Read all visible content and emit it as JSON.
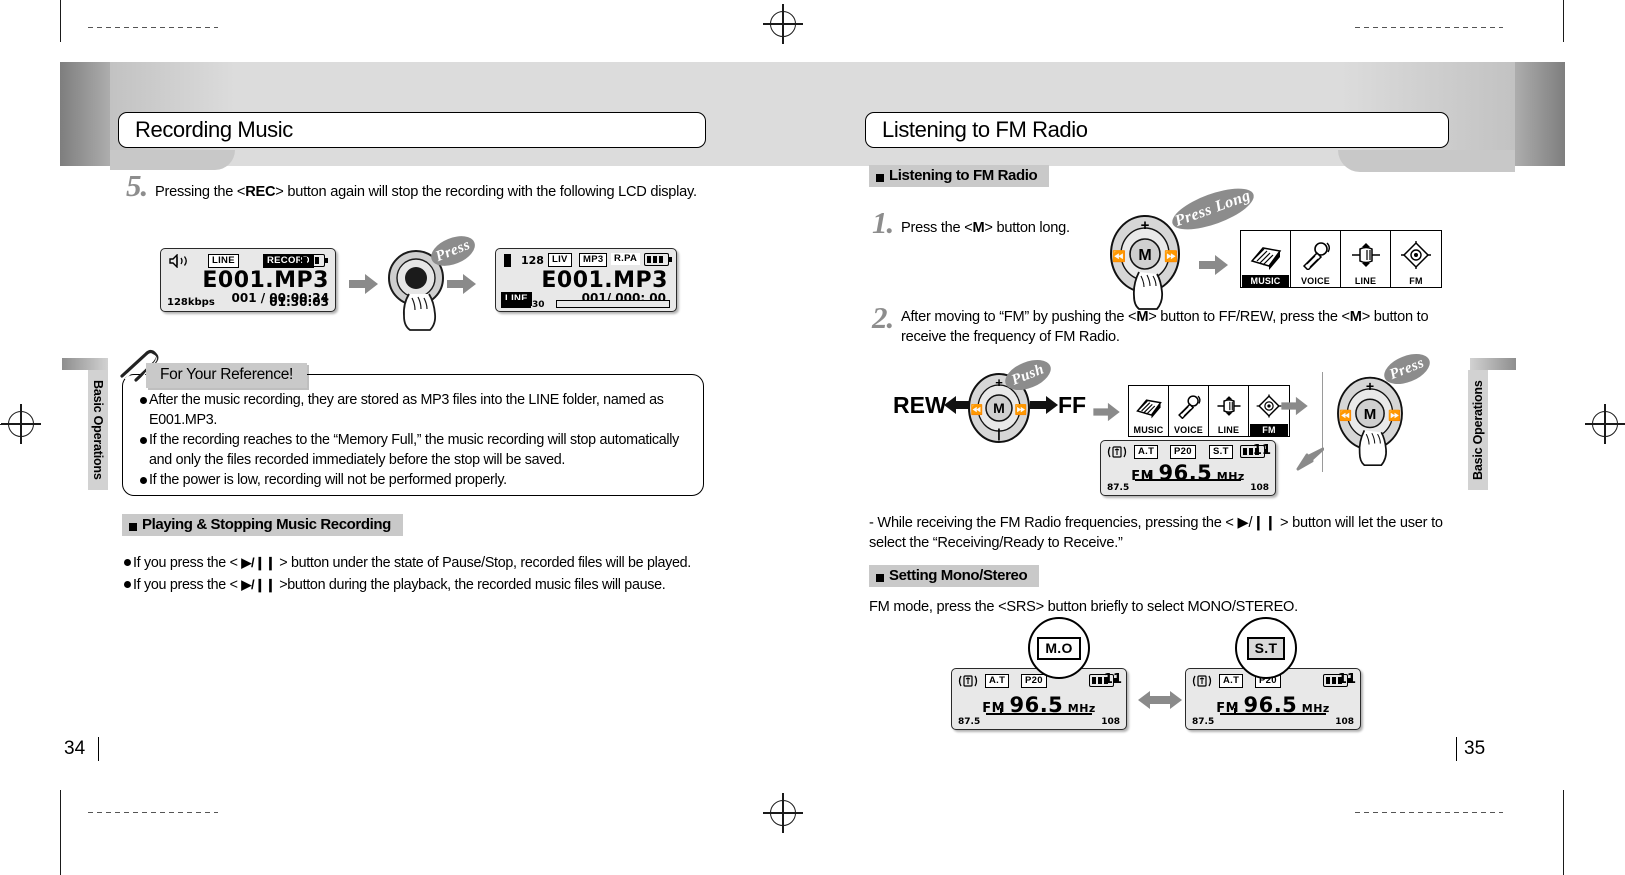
{
  "document": {
    "left_page_number": "34",
    "right_page_number": "35",
    "left_side_tab": "Basic Operations",
    "right_side_tab": "Basic Operations"
  },
  "left_page": {
    "title": "Recording Music",
    "step5": {
      "number": "5.",
      "text_before": "Pressing the <",
      "bold": "REC",
      "text_after": "> button again will stop the recording with the following LCD display."
    },
    "lcd_recording": {
      "badge_line": "LINE",
      "badge_record": "RECORD",
      "filename": "E001.MP3",
      "track_time": "001 / 00:00:24",
      "bitrate": "128kbps",
      "total_time": "01:30:03"
    },
    "lcd_stopped": {
      "bitrate": "128",
      "badge_liv": "LIV",
      "badge_mp3": "MP3",
      "badge_rpa": "R.PA",
      "filename": "E001.MP3",
      "track_time": "001/  000: 00",
      "badge_line": "LINE",
      "volume": "30"
    },
    "press_label": "Press",
    "reference": {
      "tab_label": "For Your Reference!",
      "items": [
        "After the music recording, they are stored as MP3 files into the LINE folder, named as E001.MP3.",
        "If the recording reaches to the “Memory Full,” the music recording will stop automatically and only the files recorded immediately before the stop will be saved.",
        "If the power is low, recording will not be performed properly."
      ]
    },
    "playing_section": {
      "heading": "Playing & Stopping Music Recording",
      "items": [
        {
          "pre": "If you press the < ",
          "glyph": "▶/❙❙",
          "post": " > button under the state of Pause/Stop, recorded files will be played."
        },
        {
          "pre": "If you press the < ",
          "glyph": "▶/❙❙",
          "post": " >button during the playback, the recorded music files will pause."
        }
      ]
    }
  },
  "right_page": {
    "title": "Listening to FM Radio",
    "section1_heading": "Listening to FM Radio",
    "step1": {
      "number": "1.",
      "text_before": "Press the <",
      "bold": "M",
      "text_after": "> button long."
    },
    "step2": {
      "number": "2.",
      "text": "After moving to “FM” by pushing the <M> button to FF/REW, press the <M> button to receive the frequency of FM Radio.",
      "segments": [
        "After moving to “FM” by pushing the <",
        "M",
        "> button to FF/REW, press the <",
        "M",
        "> button to receive the frequency of FM Radio."
      ]
    },
    "press_long_label": "Press Long",
    "push_label": "Push",
    "press_label": "Press",
    "rew_label": "REW",
    "ff_label": "FF",
    "mode_icons": [
      {
        "label": "MUSIC",
        "selected": true,
        "icon": "music-books-icon"
      },
      {
        "label": "VOICE",
        "selected": false,
        "icon": "microphone-icon"
      },
      {
        "label": "LINE",
        "selected": false,
        "icon": "line-in-icon"
      },
      {
        "label": "FM",
        "selected": false,
        "icon": "fm-radio-icon"
      }
    ],
    "mode_icons_fm": [
      {
        "label": "MUSIC",
        "selected": false,
        "icon": "music-books-icon"
      },
      {
        "label": "VOICE",
        "selected": false,
        "icon": "microphone-icon"
      },
      {
        "label": "LINE",
        "selected": false,
        "icon": "line-in-icon"
      },
      {
        "label": "FM",
        "selected": true,
        "icon": "fm-radio-icon"
      }
    ],
    "lcd_fm": {
      "badge_at": "A.T",
      "badge_p20": "P20",
      "badge_st": "S.T",
      "volume": "11",
      "band": "FM",
      "frequency": "96.5",
      "unit": "MHz",
      "scale_min": "87.5",
      "scale_max": "108"
    },
    "note": "- While receiving the FM Radio frequencies, pressing the < ▶/❙❙ > button will let the user to select the “Receiving/Ready to Receive.”",
    "section2_heading": "Setting Mono/Stereo",
    "mono_stereo_text": "FM mode, press the <SRS> button briefly to select MONO/STEREO.",
    "lcd_mono": {
      "badge_at": "A.T",
      "badge_p20": "P20",
      "callout": "M.O",
      "volume": "11",
      "band": "FM",
      "frequency": "96.5",
      "unit": "MHz",
      "scale_min": "87.5",
      "scale_max": "108"
    },
    "lcd_stereo": {
      "badge_at": "A.T",
      "badge_p20": "P20",
      "callout": "S.T",
      "volume": "11",
      "band": "FM",
      "frequency": "96.5",
      "unit": "MHz",
      "scale_min": "87.5",
      "scale_max": "108"
    }
  },
  "dial": {
    "plus": "+",
    "minus": "|",
    "center": "M",
    "prev": "❘◀◀",
    "next": "▶▶❘"
  }
}
